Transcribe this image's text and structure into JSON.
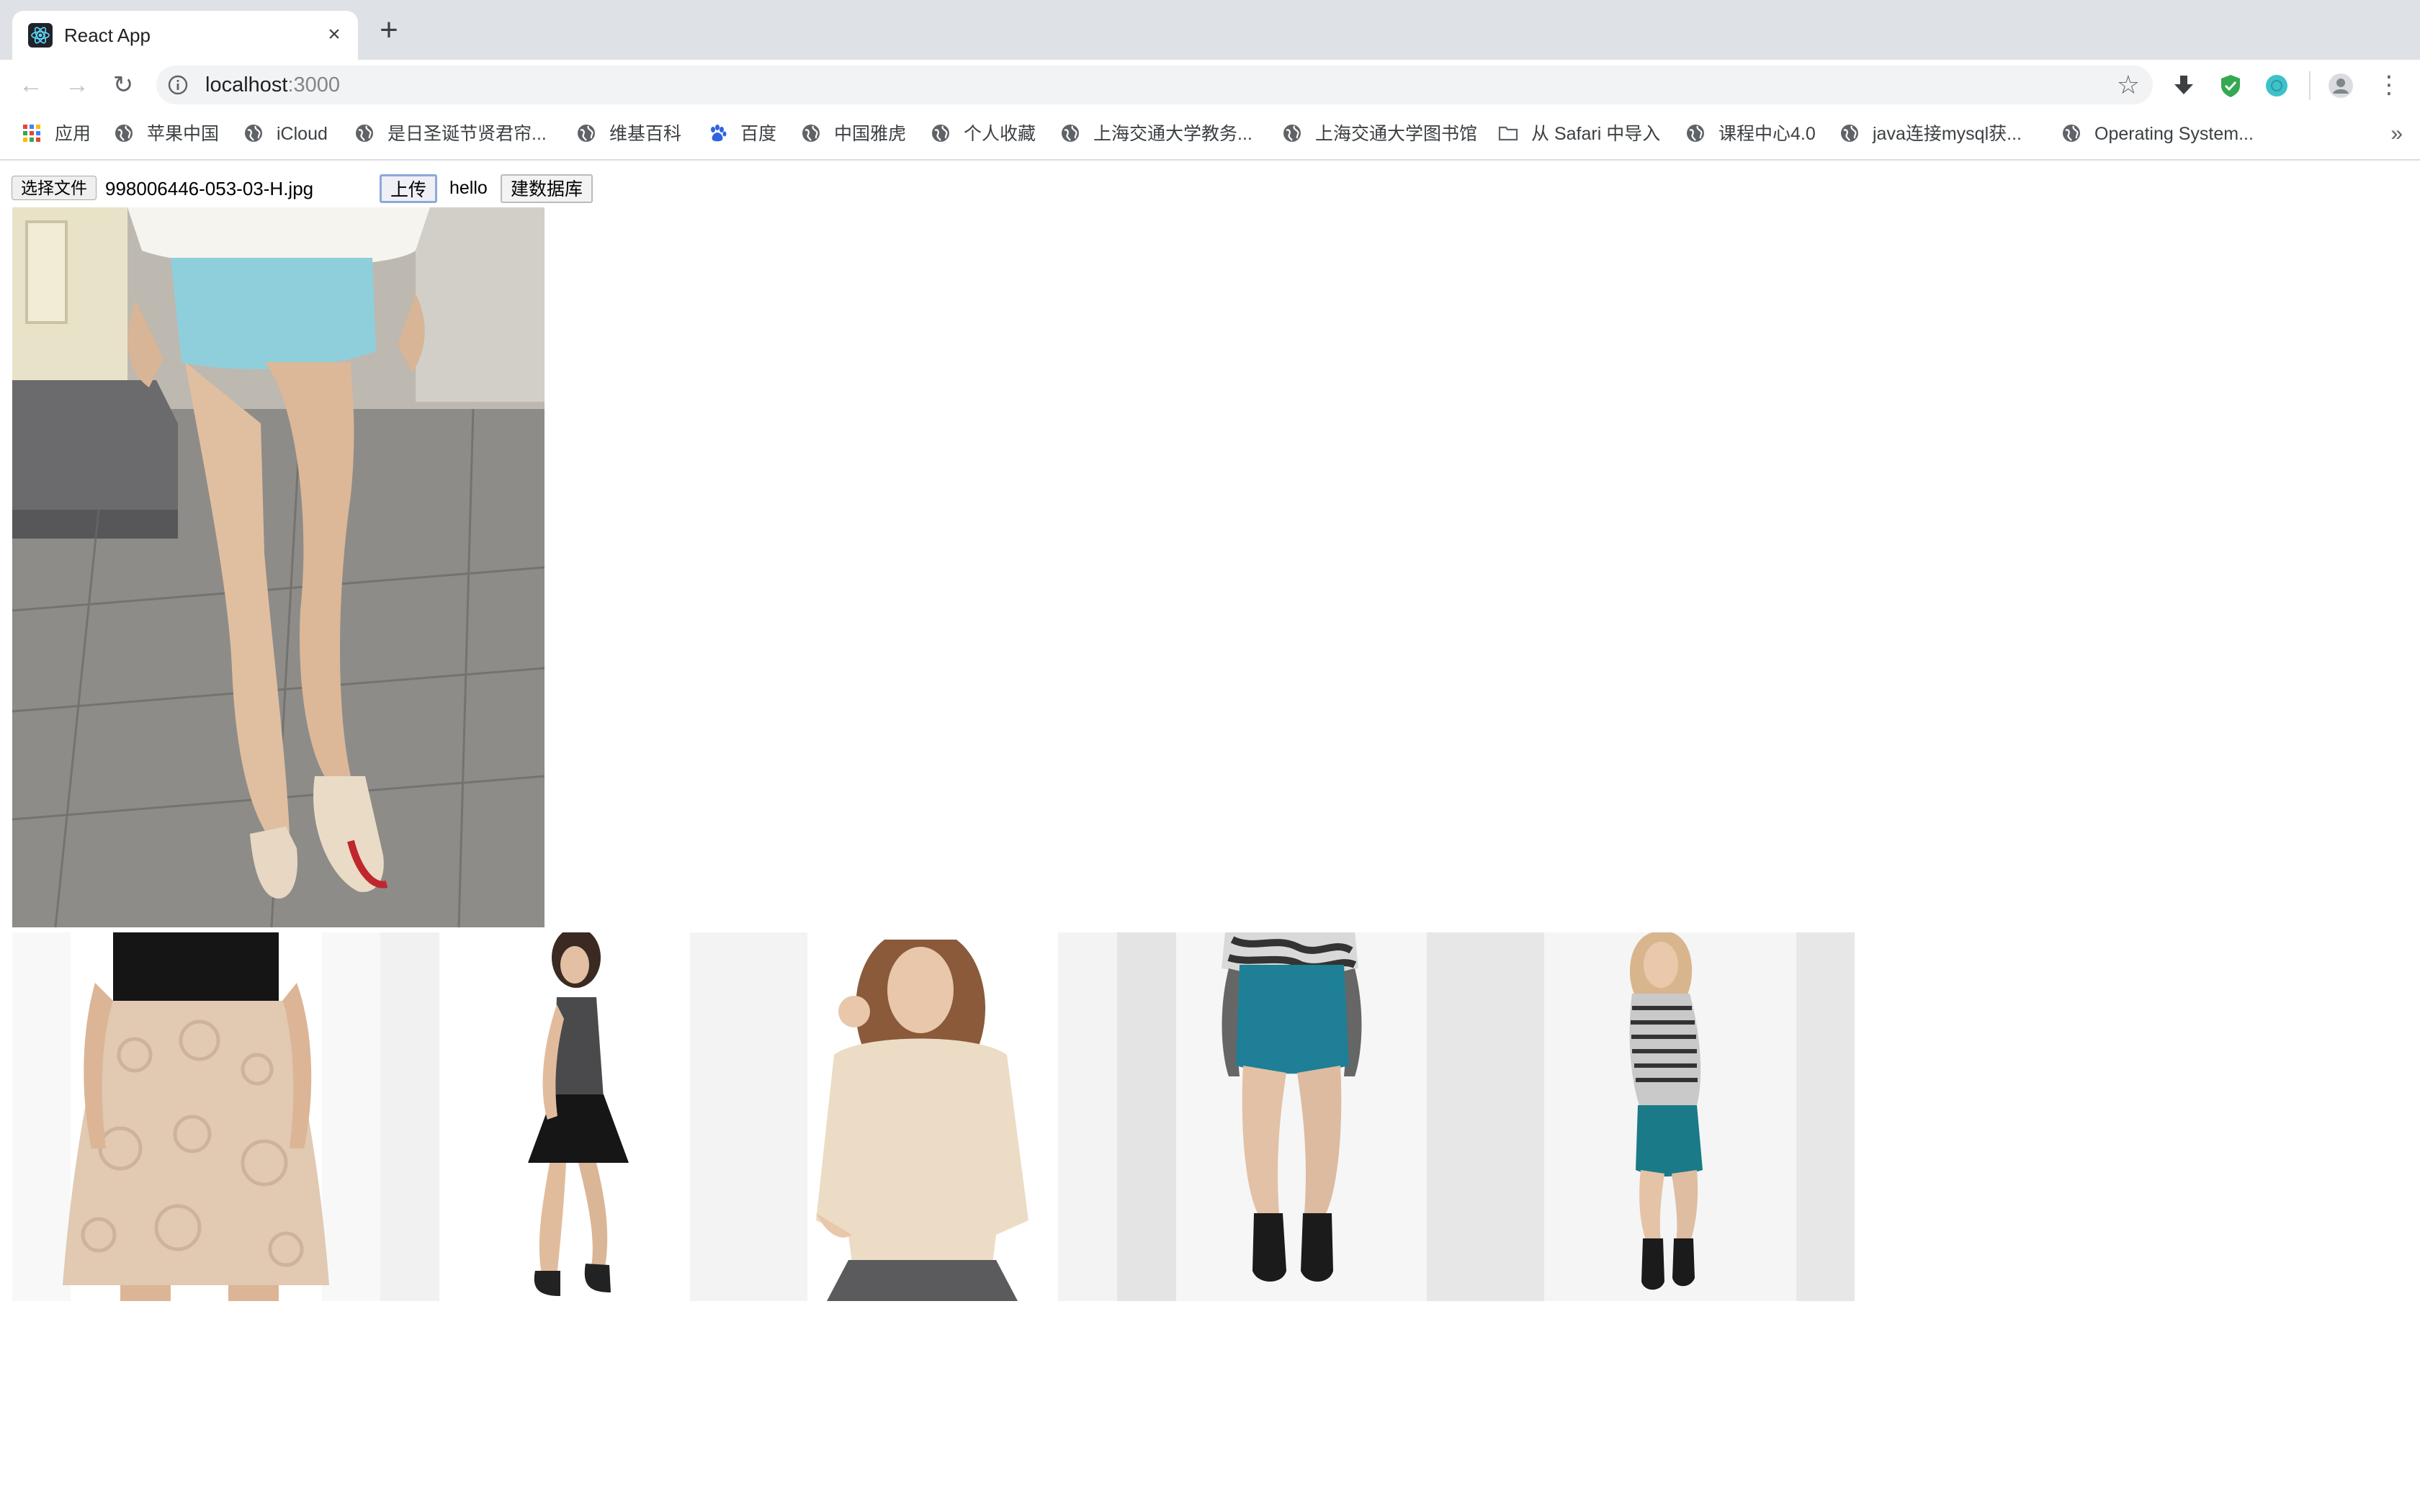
{
  "browser": {
    "tab_title": "React App",
    "tab_close": "×",
    "new_tab": "+",
    "url_host": "localhost",
    "url_port": ":3000",
    "back": "←",
    "forward": "→",
    "reload": "↻",
    "star": "☆",
    "menu": "⋮"
  },
  "bookmarks": {
    "items": [
      {
        "label": "应用",
        "icon": "apps-grid-icon"
      },
      {
        "label": "苹果中国",
        "icon": "globe-icon"
      },
      {
        "label": "iCloud",
        "icon": "globe-icon"
      },
      {
        "label": "是日圣诞节贤君帘...",
        "icon": "globe-icon"
      },
      {
        "label": "维基百科",
        "icon": "globe-icon"
      },
      {
        "label": "百度",
        "icon": "baidu-paw-icon"
      },
      {
        "label": "中国雅虎",
        "icon": "globe-icon"
      },
      {
        "label": "个人收藏",
        "icon": "globe-icon"
      },
      {
        "label": "上海交通大学教务...",
        "icon": "globe-icon"
      },
      {
        "label": "上海交通大学图书馆",
        "icon": "globe-icon"
      },
      {
        "label": "从 Safari 中导入",
        "icon": "folder-icon"
      },
      {
        "label": "课程中心4.0",
        "icon": "globe-icon"
      },
      {
        "label": "java连接mysql获...",
        "icon": "globe-icon"
      },
      {
        "label": "Operating System...",
        "icon": "globe-icon"
      }
    ],
    "more": "»"
  },
  "page": {
    "choose_file_label": "选择文件",
    "file_name": "998006446-053-03-H.jpg",
    "upload_label": "上传",
    "hello_label": "hello",
    "build_db_label": "建数据库"
  },
  "colors": {
    "tabstrip_bg": "#dee1e6",
    "omnibox_bg": "#f1f3f4",
    "skirt_blue": "#8fcfdc",
    "teal_skirt": "#1e7f97",
    "focus_border": "#8ea8d9"
  }
}
